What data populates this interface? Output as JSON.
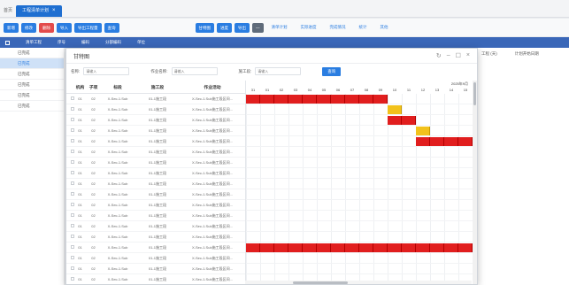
{
  "app": {
    "home": "首页",
    "tab_label": "工程清单计划",
    "tab_close": "×"
  },
  "toolbar": {
    "btn_add": "新增",
    "btn_edit": "修改",
    "btn_delete": "删除",
    "btn_import": "导入",
    "btn_export_plan": "导出工程量",
    "btn_query": "查询",
    "btn_r1": "甘特图",
    "btn_r2": "进度",
    "btn_r3": "导出",
    "btn_r4": "—",
    "link1": "清单计划",
    "link2": "实际进度",
    "link3": "完成情况",
    "link4": "统计",
    "link5": "其他"
  },
  "grid_head": [
    "清单工程",
    "序号",
    "编码",
    "分部编码",
    "单位"
  ],
  "side_list": [
    "已完成",
    "已完成",
    "已完成",
    "已完成",
    "已完成",
    "已完成"
  ],
  "right_strip": {
    "col1": "工程 (天)",
    "col2": "计划开始日期"
  },
  "dialog": {
    "title": "甘特图",
    "ctrl_refresh": "↻",
    "ctrl_min": "–",
    "ctrl_max": "☐",
    "ctrl_close": "×",
    "filter": {
      "label1": "名称:",
      "ph1": "请输入",
      "label2": "作业名称:",
      "ph2": "请输入",
      "label3": "施工段:",
      "ph3": "请输入",
      "search": "查询"
    }
  },
  "gantt": {
    "headers": [
      "",
      "机构",
      "子项",
      "标段",
      "施工段",
      "作业活动"
    ],
    "month": "2025年9月",
    "days": [
      "31",
      "01",
      "02",
      "03",
      "04",
      "05",
      "06",
      "07",
      "08",
      "09",
      "10",
      "11",
      "12",
      "13",
      "14",
      "15",
      "16"
    ],
    "rows": [
      [
        "01",
        "02",
        "X-Sec-1.Sub",
        "01-1施工段",
        "X-Sec-1.Sub施工段区间..."
      ],
      [
        "01",
        "02",
        "X-Sec-1.Sub",
        "01-1施工段",
        "X-Sec-1.Sub施工段区间..."
      ],
      [
        "01",
        "02",
        "X-Sec-1.Sub",
        "01-1施工段",
        "X-Sec-1.Sub施工段区间..."
      ],
      [
        "01",
        "02",
        "X-Sec-1.Sub",
        "01-1施工段",
        "X-Sec-1.Sub施工段区间..."
      ],
      [
        "01",
        "02",
        "X-Sec-1.Sub",
        "01-1施工段",
        "X-Sec-1.Sub施工段区间..."
      ],
      [
        "01",
        "02",
        "X-Sec-1.Sub",
        "01-1施工段",
        "X-Sec-1.Sub施工段区间..."
      ],
      [
        "01",
        "02",
        "X-Sec-1.Sub",
        "01-1施工段",
        "X-Sec-1.Sub施工段区间..."
      ],
      [
        "01",
        "02",
        "X-Sec-1.Sub",
        "01-1施工段",
        "X-Sec-1.Sub施工段区间..."
      ],
      [
        "01",
        "02",
        "X-Sec-1.Sub",
        "01-1施工段",
        "X-Sec-1.Sub施工段区间..."
      ],
      [
        "01",
        "02",
        "X-Sec-1.Sub",
        "01-1施工段",
        "X-Sec-1.Sub施工段区间..."
      ],
      [
        "01",
        "02",
        "X-Sec-1.Sub",
        "01-1施工段",
        "X-Sec-1.Sub施工段区间..."
      ],
      [
        "01",
        "02",
        "X-Sec-1.Sub",
        "01-1施工段",
        "X-Sec-1.Sub施工段区间..."
      ],
      [
        "01",
        "02",
        "X-Sec-1.Sub",
        "01-1施工段",
        "X-Sec-1.Sub施工段区间..."
      ],
      [
        "01",
        "02",
        "X-Sec-1.Sub",
        "01-1施工段",
        "X-Sec-1.Sub施工段区间..."
      ],
      [
        "01",
        "02",
        "X-Sec-1.Sub",
        "01-1施工段",
        "X-Sec-1.Sub施工段区间..."
      ],
      [
        "01",
        "02",
        "X-Sec-1.Sub",
        "01-1施工段",
        "X-Sec-1.Sub施工段区间..."
      ],
      [
        "01",
        "02",
        "X-Sec-1.Sub",
        "01-1施工段",
        "X-Sec-1.Sub施工段区间..."
      ],
      [
        "01",
        "02",
        "X-Sec-1.Sub",
        "01-1施工段",
        "X-Sec-1.Sub施工段区间..."
      ]
    ],
    "tasks": [
      {
        "row": 0,
        "start": 0,
        "end": 10,
        "status": "in-progress"
      },
      {
        "row": 1,
        "start": 10,
        "end": 11,
        "status": "milestone"
      },
      {
        "row": 2,
        "start": 10,
        "end": 12,
        "status": "in-progress"
      },
      {
        "row": 3,
        "start": 12,
        "end": 13,
        "status": "milestone"
      },
      {
        "row": 4,
        "start": 12,
        "end": 16,
        "status": "in-progress"
      },
      {
        "row": 14,
        "start": 0,
        "end": 16,
        "status": "in-progress"
      }
    ],
    "colors": {
      "in-progress": "#e11e1e",
      "milestone": "#f2c21b"
    }
  }
}
